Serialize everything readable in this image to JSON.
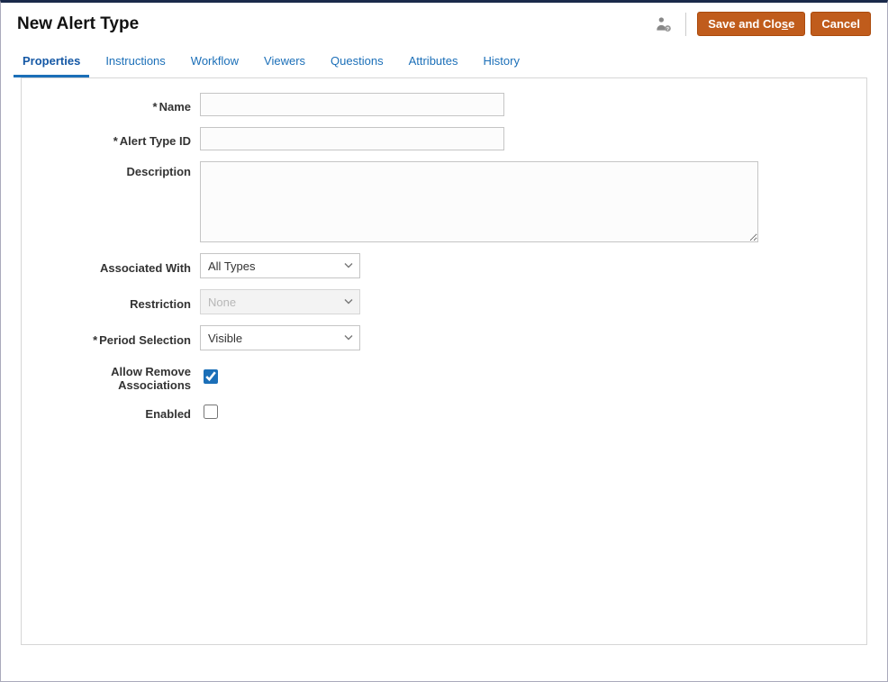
{
  "header": {
    "title": "New Alert Type",
    "save_label_pre": "Save and Clo",
    "save_label_underline": "s",
    "save_label_post": "e",
    "cancel_label": "Cancel"
  },
  "tabs": [
    {
      "label": "Properties",
      "active": true
    },
    {
      "label": "Instructions",
      "active": false
    },
    {
      "label": "Workflow",
      "active": false
    },
    {
      "label": "Viewers",
      "active": false
    },
    {
      "label": "Questions",
      "active": false
    },
    {
      "label": "Attributes",
      "active": false
    },
    {
      "label": "History",
      "active": false
    }
  ],
  "form": {
    "name": {
      "label": "Name",
      "required": true,
      "value": ""
    },
    "alert_type_id": {
      "label": "Alert Type ID",
      "required": true,
      "value": ""
    },
    "description": {
      "label": "Description",
      "required": false,
      "value": ""
    },
    "associated_with": {
      "label": "Associated With",
      "required": false,
      "selected": "All Types"
    },
    "restriction": {
      "label": "Restriction",
      "required": false,
      "selected": "None",
      "disabled": true
    },
    "period_selection": {
      "label": "Period Selection",
      "required": true,
      "selected": "Visible"
    },
    "allow_remove_associations": {
      "label": "Allow Remove Associations",
      "checked": true
    },
    "enabled": {
      "label": "Enabled",
      "checked": false
    }
  }
}
